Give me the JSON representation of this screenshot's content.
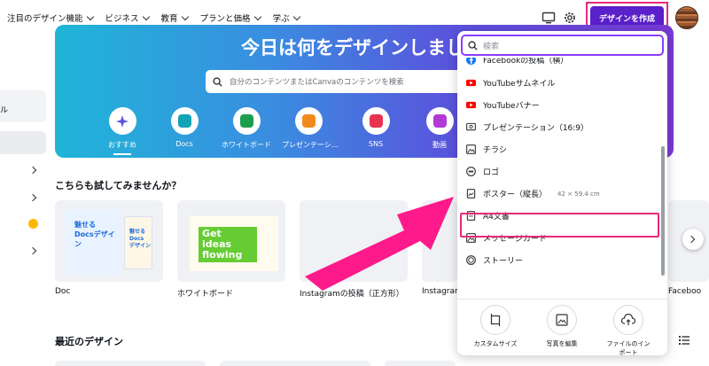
{
  "nav": {
    "items": [
      "注目のデザイン機能",
      "ビジネス",
      "教育",
      "プランと価格",
      "学ぶ"
    ],
    "create_label": "デザインを作成"
  },
  "sidebar": {
    "label": "ル"
  },
  "hero": {
    "title": "今日は何をデザインしまし",
    "search_placeholder": "自分のコンテンツまたはCanvaのコンテンツを検索",
    "categories": [
      "おすすめ",
      "Docs",
      "ホワイトボード",
      "プレゼンテーシ…",
      "SNS",
      "動画"
    ]
  },
  "try_section": {
    "title": "こちらも試してみませんか？",
    "cards": [
      {
        "label": "Doc",
        "thumb_text": "魅せる Docsデザイン",
        "thumb_text2": "魅せる Docs デザイン"
      },
      {
        "label": "ホワイトボード",
        "thumb_text": "Get ideas flowing"
      },
      {
        "label": "Instagramの投稿（正方形）"
      },
      {
        "label": "Instagram"
      },
      {
        "label": "Faceboo"
      }
    ]
  },
  "recent": {
    "title": "最近のデザイン"
  },
  "dropdown": {
    "search_placeholder": "検索",
    "items": [
      {
        "label": "Facebookの投稿（横）",
        "icon": "facebook-icon",
        "color": "#1877f2"
      },
      {
        "label": "YouTubeサムネイル",
        "icon": "youtube-icon",
        "color": "#ff0000"
      },
      {
        "label": "YouTubeバナー",
        "icon": "youtube-icon",
        "color": "#ff0000"
      },
      {
        "label": "プレゼンテーション（16:9）",
        "icon": "presentation-icon",
        "color": "#333333"
      },
      {
        "label": "チラシ",
        "icon": "image-icon",
        "color": "#333333"
      },
      {
        "label": "ロゴ",
        "icon": "logo-icon",
        "color": "#333333"
      },
      {
        "label": "ポスター（縦長）",
        "sub": "42 × 59.4 cm",
        "icon": "poster-icon",
        "color": "#333333"
      },
      {
        "label": "A4文書",
        "icon": "document-icon",
        "color": "#333333"
      },
      {
        "label": "メッセージカード",
        "icon": "image-icon",
        "color": "#333333"
      },
      {
        "label": "ストーリー",
        "icon": "story-icon",
        "color": "#333333"
      }
    ],
    "actions": [
      {
        "label": "カスタムサイズ",
        "icon": "custom-size-icon"
      },
      {
        "label": "写真を編集",
        "icon": "photo-edit-icon"
      },
      {
        "label": "ファイルのインポート",
        "icon": "upload-icon"
      }
    ]
  },
  "colors": {
    "accent": "#8b3dff",
    "create_button": "#5a20c9",
    "highlight": "#e8297a"
  }
}
